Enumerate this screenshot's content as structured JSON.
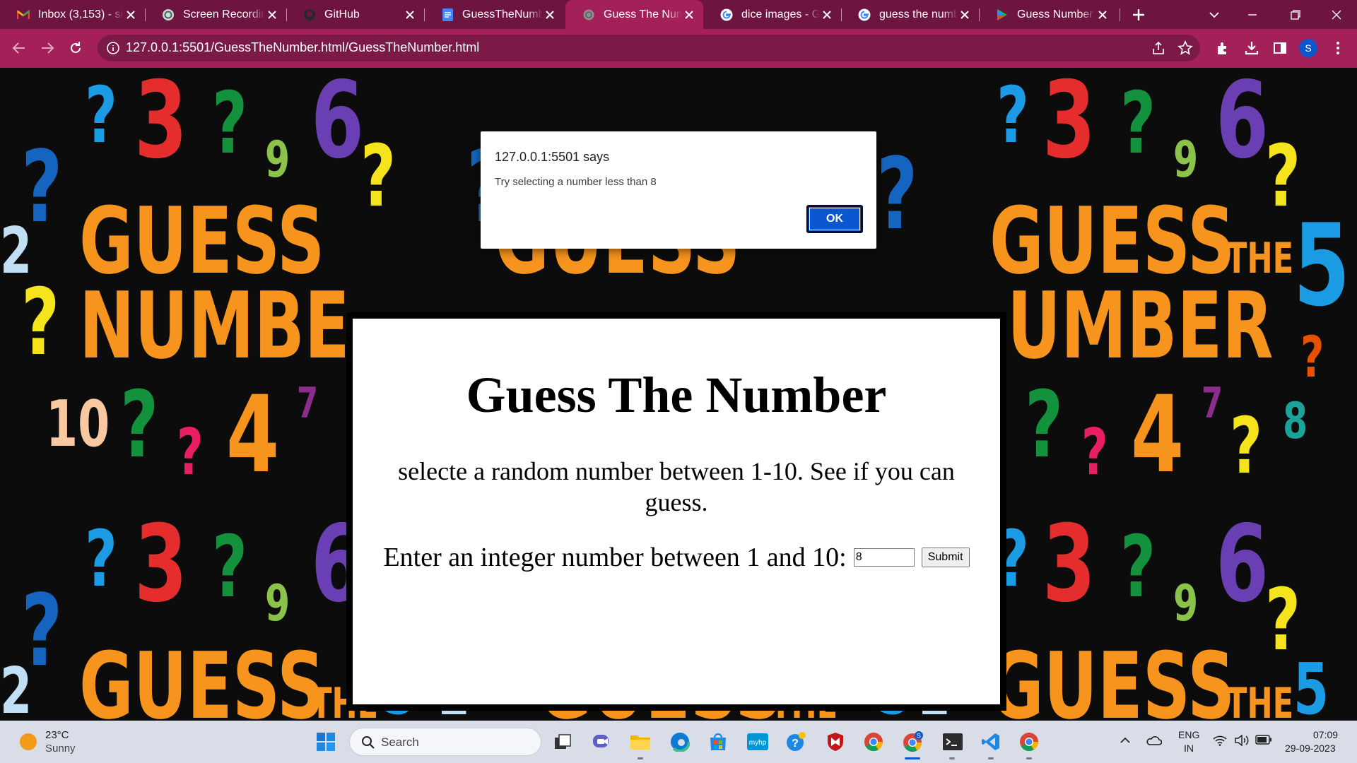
{
  "browser": {
    "tabs": [
      {
        "title": "Inbox (3,153) - si",
        "icon": "gmail-icon"
      },
      {
        "title": "Screen Recording",
        "icon": "openai-icon"
      },
      {
        "title": "GitHub",
        "icon": "github-icon"
      },
      {
        "title": "GuessTheNumber",
        "icon": "docs-icon"
      },
      {
        "title": "Guess The Number",
        "icon": "globe-icon",
        "active": true
      },
      {
        "title": "dice images - Go",
        "icon": "google-icon"
      },
      {
        "title": "guess the number",
        "icon": "google-icon"
      },
      {
        "title": "Guess Number -",
        "icon": "play-icon"
      }
    ],
    "url": "127.0.0.1:5501/GuessTheNumber.html/GuessTheNumber.html",
    "profile_initial": "S",
    "accent": "#a32059",
    "tabbar_color": "#6d1440"
  },
  "alert": {
    "origin": "127.0.0.1:5501 says",
    "message": "Try selecting a number less than 8",
    "ok_label": "OK"
  },
  "page": {
    "heading": "Guess The Number",
    "description": "selecte a random number between 1-10. See if you can guess.",
    "prompt": "Enter an integer number between 1 and 10:",
    "input_value": "8",
    "submit_label": "Submit"
  },
  "taskbar": {
    "weather_temp": "23°C",
    "weather_condition": "Sunny",
    "search_placeholder": "Search",
    "language_line1": "ENG",
    "language_line2": "IN",
    "time": "07:09",
    "date": "29-09-2023"
  }
}
